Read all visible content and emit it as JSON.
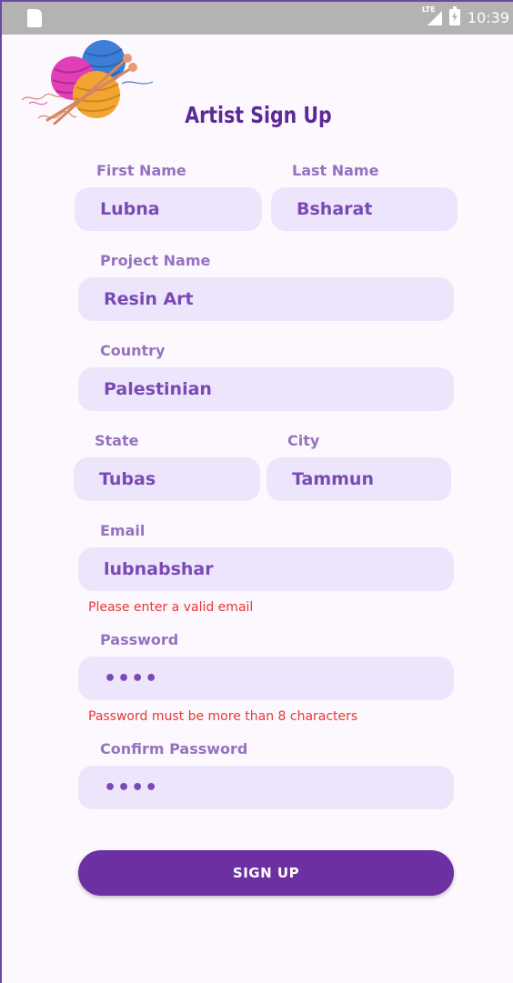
{
  "status_bar": {
    "network": "LTE",
    "time": "10:39"
  },
  "page": {
    "title": "Artist Sign Up"
  },
  "form": {
    "first_name": {
      "label": "First Name",
      "value": "Lubna"
    },
    "last_name": {
      "label": "Last Name",
      "value": "Bsharat"
    },
    "project_name": {
      "label": "Project Name",
      "value": "Resin Art"
    },
    "country": {
      "label": "Country",
      "value": "Palestinian"
    },
    "state": {
      "label": "State",
      "value": "Tubas"
    },
    "city": {
      "label": "City",
      "value": "Tammun"
    },
    "email": {
      "label": "Email",
      "value": "lubnabshar",
      "error": "Please enter a valid email"
    },
    "password": {
      "label": "Password",
      "value": "••••",
      "error": "Password must be more than 8 characters"
    },
    "confirm_password": {
      "label": "Confirm Password",
      "value": "••••"
    }
  },
  "actions": {
    "signup_label": "SIGN UP"
  },
  "colors": {
    "accent": "#6d30a2",
    "field_bg": "#ede5fb",
    "label": "#9572c0",
    "error": "#e53935"
  },
  "icons": [
    "sd-card-icon",
    "lte-signal-icon",
    "battery-charging-icon",
    "yarn-balls-logo"
  ]
}
